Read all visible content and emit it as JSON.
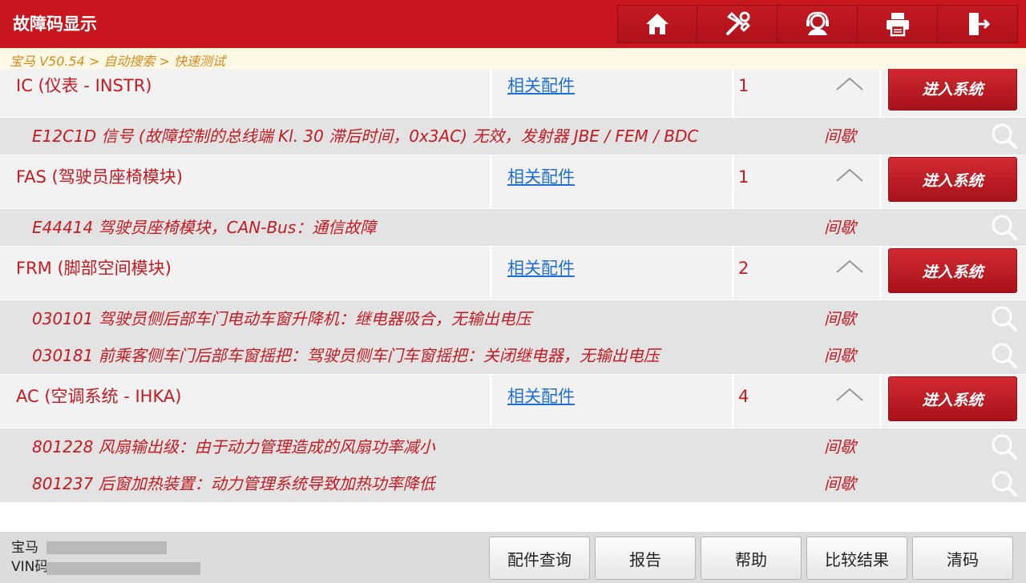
{
  "header": {
    "title": "故障码显示",
    "toolbar": [
      {
        "name": "home-button",
        "icon": "home-icon"
      },
      {
        "name": "diagnose-button",
        "icon": "tools-icon"
      },
      {
        "name": "support-button",
        "icon": "headset-icon"
      },
      {
        "name": "print-button",
        "icon": "printer-icon"
      },
      {
        "name": "exit-button",
        "icon": "exit-icon"
      }
    ]
  },
  "breadcrumb": "宝马 V50.54 > 自动搜索 > 快速测试",
  "link_label": "相关配件",
  "enter_label": "进入系统",
  "modules": [
    {
      "name": "IC (仪表 - INSTR)",
      "count": "1",
      "faults": [
        {
          "code": "E12C1D 信号 (故障控制的总线端 Kl. 30 滞后时间，0x3AC) 无效，发射器 JBE / FEM / BDC",
          "status": "间歇"
        }
      ]
    },
    {
      "name": "FAS (驾驶员座椅模块)",
      "count": "1",
      "faults": [
        {
          "code": "E44414 驾驶员座椅模块，CAN-Bus：通信故障",
          "status": "间歇"
        }
      ]
    },
    {
      "name": "FRM (脚部空间模块)",
      "count": "2",
      "faults": [
        {
          "code": "030101 驾驶员侧后部车门电动车窗升降机：继电器吸合，无输出电压",
          "status": "间歇"
        },
        {
          "code": "030181 前乘客侧车门后部车窗摇把：驾驶员侧车门车窗摇把：关闭继电器，无输出电压",
          "status": "间歇"
        }
      ]
    },
    {
      "name": "AC (空调系统 - IHKA)",
      "count": "4",
      "faults": [
        {
          "code": "801228 风扇输出级：由于动力管理造成的风扇功率减小",
          "status": "间歇"
        },
        {
          "code": "801237 后窗加热装置：动力管理系统导致加热功率降低",
          "status": "间歇"
        }
      ]
    }
  ],
  "footer": {
    "vehicle_make": "宝马",
    "vin_label": "VIN码",
    "buttons": [
      "配件查询",
      "报告",
      "帮助",
      "比较结果",
      "清码"
    ]
  }
}
